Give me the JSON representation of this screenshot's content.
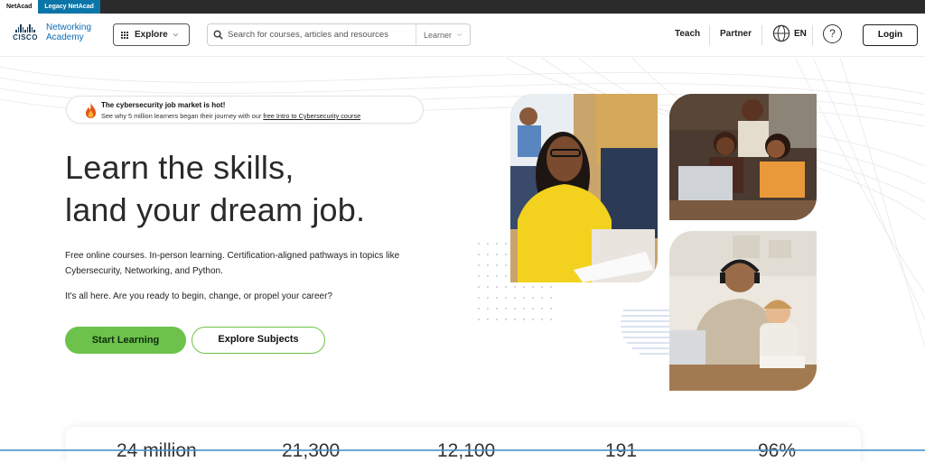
{
  "top_tabs": {
    "netacad": "NetAcad",
    "legacy": "Legacy NetAcad"
  },
  "header": {
    "logo_brand": "CISCO",
    "logo_line1": "Networking",
    "logo_line2": "Academy",
    "explore_label": "Explore",
    "search_placeholder": "Search for courses, articles and resources",
    "role_select": "Learner",
    "teach": "Teach",
    "partner": "Partner",
    "language": "EN",
    "help": "?",
    "login": "Login"
  },
  "banner": {
    "title": "The cybersecurity job market is hot!",
    "text": "See why 5 million learners began their journey with our ",
    "link": "free Intro to Cybersecurity course"
  },
  "hero": {
    "headline_line1": "Learn the skills,",
    "headline_line2": "land your dream job.",
    "description": "Free online courses. In-person learning. Certification-aligned pathways in topics like Cybersecurity, Networking, and Python.",
    "question": "It's all here. Are you ready to begin, change, or propel your career?",
    "start_button": "Start Learning",
    "explore_button": "Explore Subjects"
  },
  "stats": [
    "24 million",
    "21,300",
    "12,100",
    "191",
    "96%"
  ],
  "colors": {
    "accent_green": "#6cc24a",
    "brand_blue": "#0b6cb4",
    "legacy_tab": "#0b75a8"
  },
  "icons": [
    "grid-icon",
    "chevron-down-icon",
    "search-icon",
    "globe-icon",
    "help-icon",
    "flame-icon"
  ]
}
